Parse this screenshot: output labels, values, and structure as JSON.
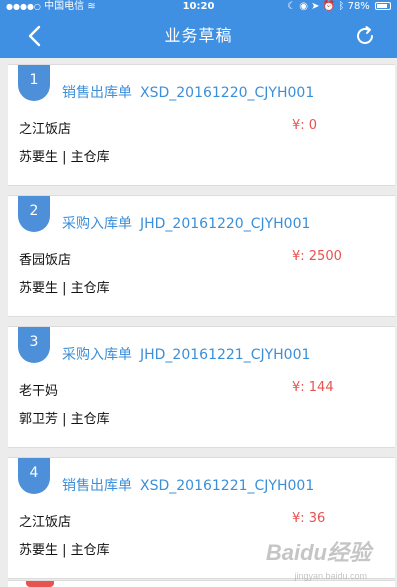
{
  "status_bar": {
    "carrier": "中国电信",
    "time": "10:20",
    "battery": "78%"
  },
  "nav": {
    "title": "业务草稿",
    "back_icon": "chevron-left-icon",
    "refresh_icon": "refresh-icon"
  },
  "drafts": [
    {
      "index": "1",
      "type": "销售出库单",
      "code": "XSD_20161220_CJYH001",
      "customer": "之江饭店",
      "amount": "¥: 0",
      "staff": "苏要生 | 主仓库"
    },
    {
      "index": "2",
      "type": "采购入库单",
      "code": "JHD_20161220_CJYH001",
      "customer": "香园饭店",
      "amount": "¥: 2500",
      "staff": "苏要生 | 主仓库"
    },
    {
      "index": "3",
      "type": "采购入库单",
      "code": "JHD_20161221_CJYH001",
      "customer": "老干妈",
      "amount": "¥: 144",
      "staff": "郭卫芳 | 主仓库"
    },
    {
      "index": "4",
      "type": "销售出库单",
      "code": "XSD_20161221_CJYH001",
      "customer": "之江饭店",
      "amount": "¥: 36",
      "staff": "苏要生 | 主仓库"
    }
  ],
  "watermark": {
    "main": "Baidu经验",
    "sub": "jingyan.baidu.com"
  },
  "colors": {
    "primary": "#3f8fe3",
    "badge": "#4d8fd9",
    "link": "#3b8fd9",
    "amount": "#e8524f",
    "background": "#ececec"
  }
}
